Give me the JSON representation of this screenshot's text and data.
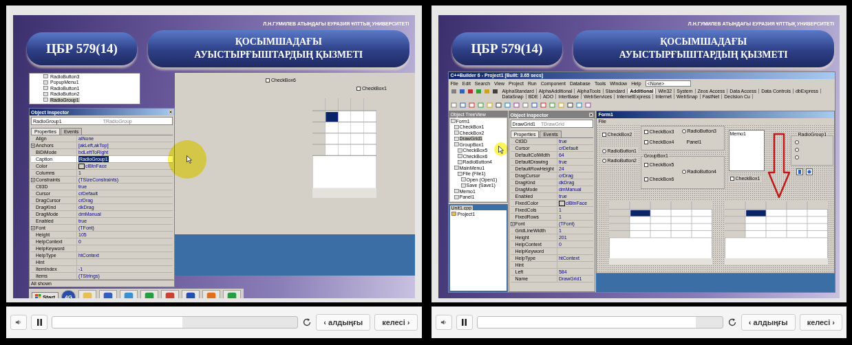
{
  "players": [
    {
      "slide": {
        "university": "Л.Н.ГУМИЛЕВ АТЫНДАҒЫ ЕУРАЗИЯ ҰЛТТЫҚ УНИВЕРСИТЕТІ",
        "code": "ЦБР 579(14)",
        "title": "ҚОСЫМШАДАҒЫ\nАУЫСТЫРҒЫШТАРДЫҢ ҚЫЗМЕТІ",
        "screenshot": {
          "kind": "inspector_close_up",
          "tree": [
            {
              "label": "RadioButton3",
              "selected": false
            },
            {
              "label": "PopupMenu1",
              "selected": false
            },
            {
              "label": "RadioButton1",
              "selected": false
            },
            {
              "label": "RadioButton2",
              "selected": false
            },
            {
              "label": "RadioGroup1",
              "selected": true
            }
          ],
          "inspector": {
            "title": "Object Inspector",
            "object": "RadioGroup1",
            "type": "TRadioGroup",
            "tabs": [
              {
                "label": "Properties",
                "selected": true
              },
              {
                "label": "Events",
                "selected": false
              }
            ],
            "rows": [
              {
                "kind": "property",
                "name": "Align",
                "value": "alNone",
                "selected": false
              },
              {
                "kind": "group",
                "name": "Anchors",
                "value": "[akLeft,akTop]",
                "selected": false
              },
              {
                "kind": "property",
                "name": "BiDiMode",
                "value": "bdLeftToRight",
                "selected": false
              },
              {
                "kind": "property",
                "name": "Caption",
                "value": "RadioGroup1",
                "selected": true
              },
              {
                "kind": "color",
                "name": "Color",
                "value": "clBtnFace",
                "selected": false
              },
              {
                "kind": "property",
                "name": "Columns",
                "value": "1",
                "selected": false
              },
              {
                "kind": "group",
                "name": "Constraints",
                "value": "(TSizeConstraints)",
                "selected": false
              },
              {
                "kind": "property",
                "name": "Ctl3D",
                "value": "true",
                "selected": false
              },
              {
                "kind": "property",
                "name": "Cursor",
                "value": "crDefault",
                "selected": false
              },
              {
                "kind": "property",
                "name": "DragCursor",
                "value": "crDrag",
                "selected": false
              },
              {
                "kind": "property",
                "name": "DragKind",
                "value": "dkDrag",
                "selected": false
              },
              {
                "kind": "property",
                "name": "DragMode",
                "value": "dmManual",
                "selected": false
              },
              {
                "kind": "property",
                "name": "Enabled",
                "value": "true",
                "selected": false
              },
              {
                "kind": "group",
                "name": "Font",
                "value": "(TFont)",
                "selected": false
              },
              {
                "kind": "property",
                "name": "Height",
                "value": "105",
                "selected": false
              },
              {
                "kind": "property",
                "name": "HelpContext",
                "value": "0",
                "selected": false
              },
              {
                "kind": "property",
                "name": "HelpKeyword",
                "selected": false
              },
              {
                "kind": "property",
                "name": "HelpType",
                "value": "htContext",
                "selected": false
              },
              {
                "kind": "property",
                "name": "Hint",
                "selected": false
              },
              {
                "kind": "property",
                "name": "ItemIndex",
                "value": "-1",
                "selected": false
              },
              {
                "kind": "property",
                "name": "Items",
                "value": "(TStrings)",
                "selected": false
              }
            ],
            "status": "All shown"
          },
          "taskbar": {
            "start": "Start",
            "badge": "4G"
          },
          "designer": [
            {
              "kind": "checkbox",
              "label": "CheckBox6",
              "checked": false
            },
            {
              "kind": "checkbox",
              "label": "CheckBox1",
              "checked": false
            }
          ]
        }
      },
      "controls": {
        "level": 0.53,
        "previous": "‹ алдыңғы",
        "next": "келесі ›"
      }
    },
    {
      "slide": {
        "university": "Л.Н.ГУМИЛЕВ АТЫНДАҒЫ ЕУРАЗИЯ ҰЛТТЫҚ УНИВЕРСИТЕТІ",
        "code": "ЦБР 579(14)",
        "title": "ҚОСЫМШАДАҒЫ\nАУЫСТЫРҒЫШТАРДЫҢ ҚЫЗМЕТІ",
        "screenshot": {
          "kind": "ide_window",
          "title": "C++Builder 6 - Project1 [Built: 3.65 secs]",
          "menu": [
            "File",
            "Edit",
            "Search",
            "View",
            "Project",
            "Run",
            "Component",
            "Database",
            "Tools",
            "Window",
            "Help"
          ],
          "config": "<None>",
          "palette_tabs": [
            {
              "label": "AlphaStandard",
              "selected": false
            },
            {
              "label": "AlphaAdditional",
              "selected": false
            },
            {
              "label": "AlphaTools",
              "selected": false
            },
            {
              "label": "Standard",
              "selected": false
            },
            {
              "label": "Additional",
              "selected": true
            },
            {
              "label": "Win32",
              "selected": false
            },
            {
              "label": "System",
              "selected": false
            },
            {
              "label": "Zeos Access",
              "selected": false
            },
            {
              "label": "Data Access",
              "selected": false
            },
            {
              "label": "Data Controls",
              "selected": false
            },
            {
              "label": "dbExpress",
              "selected": false
            },
            {
              "label": "DataSnap",
              "selected": false
            },
            {
              "label": "BDE",
              "selected": false
            },
            {
              "label": "ADO",
              "selected": false
            },
            {
              "label": "InterBase",
              "selected": false
            },
            {
              "label": "WebServices",
              "selected": false
            },
            {
              "label": "InternetExpress",
              "selected": false
            },
            {
              "label": "Internet",
              "selected": false
            },
            {
              "label": "WebSnap",
              "selected": false
            },
            {
              "label": "FastNet",
              "selected": false
            },
            {
              "label": "Decision Cu",
              "selected": false
            }
          ],
          "tree_title": "Object TreeView",
          "tree": [
            {
              "label": "Form1",
              "selected": false,
              "children": [
                {
                  "label": "CheckBox1",
                  "selected": false
                },
                {
                  "label": "CheckBox2",
                  "selected": false
                },
                {
                  "label": "DrawGrid1",
                  "selected": true
                },
                {
                  "label": "GroupBox1",
                  "selected": false,
                  "children": [
                    {
                      "label": "CheckBox5",
                      "selected": false
                    },
                    {
                      "label": "CheckBox6",
                      "selected": false
                    },
                    {
                      "label": "RadioButton4",
                      "selected": false
                    }
                  ]
                },
                {
                  "label": "MainMenu1",
                  "selected": false,
                  "children": [
                    {
                      "label": "File (File1)",
                      "selected": false,
                      "children": [
                        {
                          "label": "Open (Open1)",
                          "selected": false
                        },
                        {
                          "label": "Save (Save1)",
                          "selected": false
                        }
                      ]
                    }
                  ]
                },
                {
                  "label": "Memo1",
                  "selected": false
                },
                {
                  "label": "Panel1",
                  "selected": false
                }
              ]
            }
          ],
          "editor_tab": "Unit1.cpp",
          "project_node": "Project1",
          "inspector": {
            "title": "Object Inspector",
            "object": "DrawGrid1",
            "type": "TDrawGrid",
            "tabs": [
              {
                "label": "Properties",
                "selected": true
              },
              {
                "label": "Events",
                "selected": false
              }
            ],
            "rows": [
              {
                "kind": "property",
                "name": "Ctl3D",
                "value": "true",
                "selected": false
              },
              {
                "kind": "property",
                "name": "Cursor",
                "value": "crDefault",
                "selected": false
              },
              {
                "kind": "property",
                "name": "DefaultColWidth",
                "value": "64",
                "selected": false
              },
              {
                "kind": "property",
                "name": "DefaultDrawing",
                "value": "true",
                "selected": false
              },
              {
                "kind": "property",
                "name": "DefaultRowHeight",
                "value": "24",
                "selected": false
              },
              {
                "kind": "property",
                "name": "DragCursor",
                "value": "crDrag",
                "selected": false
              },
              {
                "kind": "property",
                "name": "DragKind",
                "value": "dkDrag",
                "selected": false
              },
              {
                "kind": "property",
                "name": "DragMode",
                "value": "dmManual",
                "selected": false
              },
              {
                "kind": "property",
                "name": "Enabled",
                "value": "true",
                "selected": false
              },
              {
                "kind": "color",
                "name": "FixedColor",
                "value": "clBtnFace",
                "selected": false
              },
              {
                "kind": "property",
                "name": "FixedCols",
                "value": "1",
                "selected": false
              },
              {
                "kind": "property",
                "name": "FixedRows",
                "value": "1",
                "selected": false
              },
              {
                "kind": "group",
                "name": "Font",
                "value": "(TFont)",
                "selected": false
              },
              {
                "kind": "property",
                "name": "GridLineWidth",
                "value": "1",
                "selected": false
              },
              {
                "kind": "property",
                "name": "Height",
                "value": "201",
                "selected": false
              },
              {
                "kind": "property",
                "name": "HelpContext",
                "value": "0",
                "selected": false
              },
              {
                "kind": "property",
                "name": "HelpKeyword",
                "selected": false
              },
              {
                "kind": "property",
                "name": "HelpType",
                "value": "htContext",
                "selected": false
              },
              {
                "kind": "property",
                "name": "Hint",
                "selected": false
              },
              {
                "kind": "property",
                "name": "Left",
                "value": "584",
                "selected": false
              },
              {
                "kind": "property",
                "name": "Name",
                "value": "DrawGrid1",
                "selected": false
              }
            ]
          },
          "form": {
            "title": "Form1",
            "menu": [
              "File"
            ],
            "controls": [
              {
                "kind": "checkbox",
                "label": "CheckBox2",
                "checked": false
              },
              {
                "kind": "radio",
                "label": "RadioButton1",
                "checked": false
              },
              {
                "kind": "radio",
                "label": "RadioButton2",
                "checked": false
              },
              {
                "kind": "checkbox",
                "label": "CheckBox1",
                "checked": false
              }
            ],
            "panel": {
              "caption": "Panel1",
              "controls": [
                {
                  "kind": "checkbox",
                  "label": "CheckBox3",
                  "checked": false
                },
                {
                  "kind": "radio",
                  "label": "RadioButton3",
                  "checked": false
                },
                {
                  "kind": "checkbox",
                  "label": "CheckBox4",
                  "checked": false
                }
              ]
            },
            "group_box": {
              "caption": "GroupBox1",
              "controls": [
                {
                  "kind": "checkbox",
                  "label": "CheckBox5",
                  "checked": false
                },
                {
                  "kind": "radio",
                  "label": "RadioButton4",
                  "checked": false
                },
                {
                  "kind": "checkbox",
                  "label": "CheckBox6",
                  "checked": false
                }
              ]
            },
            "memo": "Memo1",
            "radio_group": {
              "caption": "RadioGroup1",
              "controls": [
                {
                  "kind": "radio",
                  "checked": false
                },
                {
                  "kind": "radio",
                  "checked": false
                },
                {
                  "kind": "radio",
                  "checked": false
                }
              ]
            }
          }
        }
      },
      "controls": {
        "level": 0.89,
        "previous": "‹ алдыңғы",
        "next": "келесі ›"
      }
    }
  ]
}
